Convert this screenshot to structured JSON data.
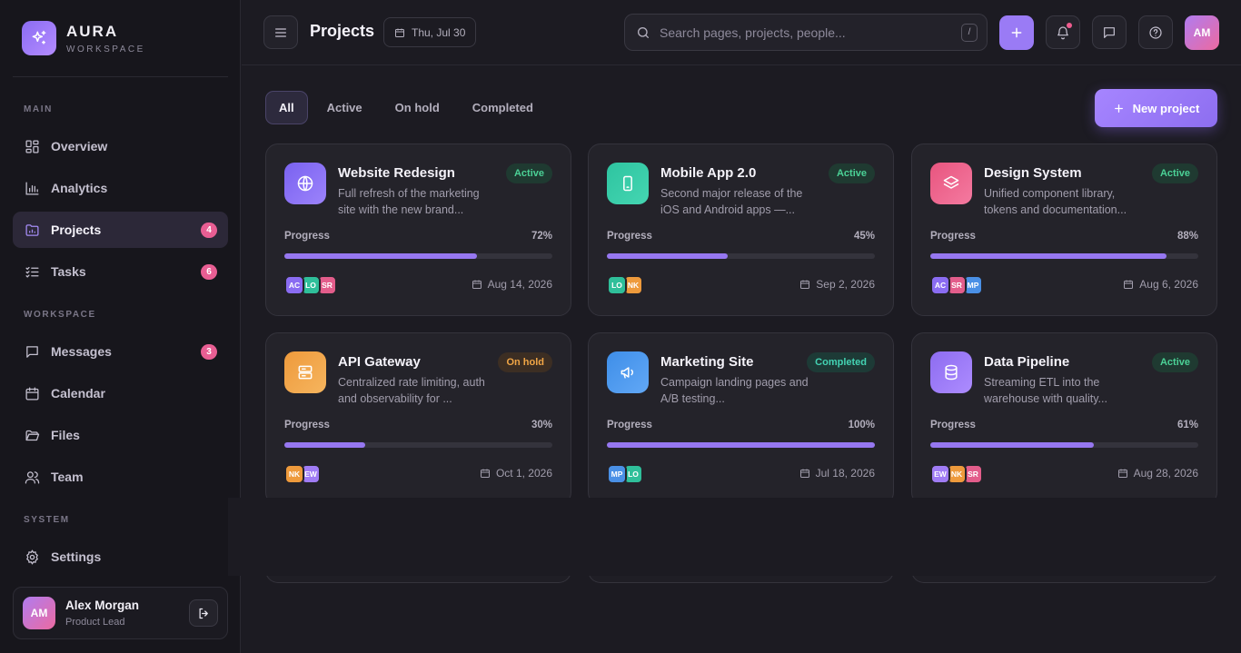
{
  "brand": {
    "name": "AURA",
    "sub": "WORKSPACE"
  },
  "sidebar": {
    "sections": {
      "main": "MAIN",
      "workspace": "WORKSPACE",
      "system": "SYSTEM"
    },
    "items": [
      {
        "label": "Overview",
        "icon": "grid-icon"
      },
      {
        "label": "Analytics",
        "icon": "bar-chart-icon"
      },
      {
        "label": "Projects",
        "icon": "folder-icon",
        "badge": "4",
        "active": true
      },
      {
        "label": "Tasks",
        "icon": "checklist-icon",
        "badge": "6"
      },
      {
        "label": "Messages",
        "icon": "message-icon",
        "badge": "3"
      },
      {
        "label": "Calendar",
        "icon": "calendar-icon"
      },
      {
        "label": "Files",
        "icon": "folder-open-icon"
      },
      {
        "label": "Team",
        "icon": "users-icon"
      },
      {
        "label": "Settings",
        "icon": "gear-icon"
      }
    ],
    "user": {
      "initials": "AM",
      "name": "Alex Morgan",
      "role": "Product Lead"
    }
  },
  "header": {
    "title": "Projects",
    "date": "Thu, Jul 30",
    "search_placeholder": "Search pages, projects, people...",
    "search_shortcut": "/",
    "avatar_initials": "AM"
  },
  "filters": {
    "tabs": [
      "All",
      "Active",
      "On hold",
      "Completed"
    ],
    "active": "All"
  },
  "new_project_label": "New project",
  "progress_label": "Progress",
  "colors": {
    "accent": "#9677f0",
    "active": "#4bd196",
    "on_hold": "#f1a646",
    "completed": "#43d3b3",
    "badge": "#e85e93"
  },
  "projects": [
    {
      "title": "Website Redesign",
      "desc": "Full refresh of the marketing site with the new brand...",
      "status": "Active",
      "progress": "72%",
      "date": "Aug 14, 2026",
      "icon": "globe-icon",
      "avatars": [
        "AC",
        "LO",
        "SR"
      ]
    },
    {
      "title": "Mobile App 2.0",
      "desc": "Second major release of the iOS and Android apps —...",
      "status": "Active",
      "progress": "45%",
      "date": "Sep 2, 2026",
      "icon": "phone-icon",
      "avatars": [
        "LO",
        "NK"
      ]
    },
    {
      "title": "Design System",
      "desc": "Unified component library, tokens and documentation...",
      "status": "Active",
      "progress": "88%",
      "date": "Aug 6, 2026",
      "icon": "layers-icon",
      "avatars": [
        "AC",
        "SR",
        "MP"
      ]
    },
    {
      "title": "API Gateway",
      "desc": "Centralized rate limiting, auth and observability for ...",
      "status": "On hold",
      "progress": "30%",
      "date": "Oct 1, 2026",
      "icon": "server-icon",
      "avatars": [
        "NK",
        "EW"
      ]
    },
    {
      "title": "Marketing Site",
      "desc": "Campaign landing pages and A/B testing...",
      "status": "Completed",
      "progress": "100%",
      "date": "Jul 18, 2026",
      "icon": "megaphone-icon",
      "avatars": [
        "MP",
        "LO"
      ]
    },
    {
      "title": "Data Pipeline",
      "desc": "Streaming ETL into the warehouse with quality...",
      "status": "Active",
      "progress": "61%",
      "date": "Aug 28, 2026",
      "icon": "database-icon",
      "avatars": [
        "EW",
        "NK",
        "SR"
      ]
    }
  ]
}
